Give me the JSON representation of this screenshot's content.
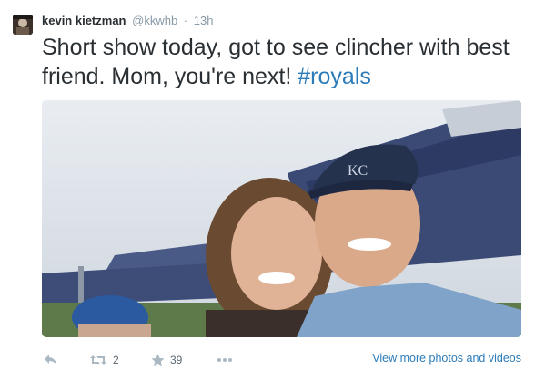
{
  "tweet": {
    "author_name": "kevin kietzman",
    "author_handle": "@kkwhb",
    "separator": "·",
    "timestamp": "13h",
    "text_main": "Short show today, got to see clincher with best friend.  Mom, you're next! ",
    "hashtag": "#royals"
  },
  "actions": {
    "retweet_count": "2",
    "favorite_count": "39",
    "view_more_label": "View more photos and videos"
  },
  "icons": {
    "reply": "reply-icon",
    "retweet": "retweet-icon",
    "favorite": "star-icon",
    "more": "more-icon"
  },
  "colors": {
    "link": "#2b7bb9",
    "muted": "#8899a6",
    "text": "#292f33"
  }
}
